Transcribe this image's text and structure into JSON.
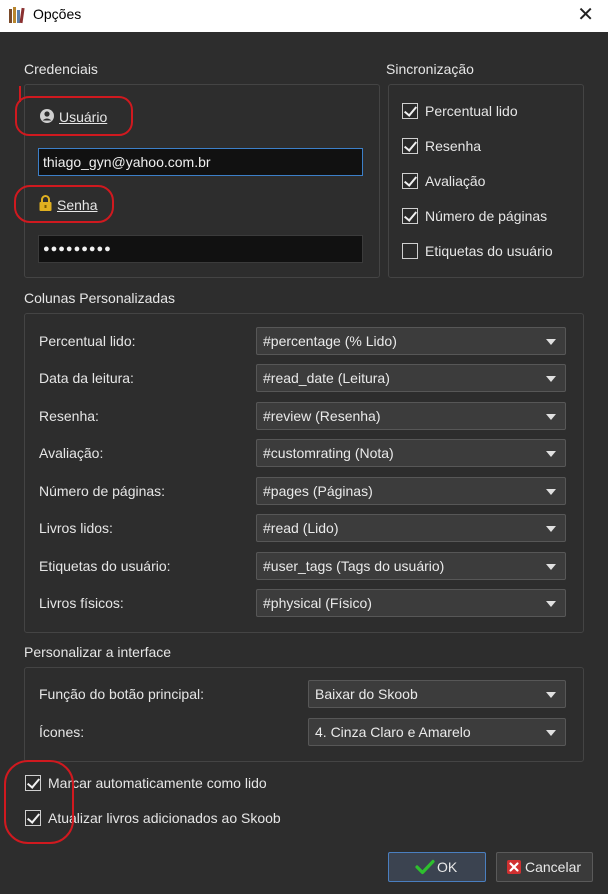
{
  "window": {
    "title": "Opções",
    "close_glyph": "✕"
  },
  "credentials": {
    "group_title": "Credenciais",
    "user_label": "Usuário",
    "user_value": "thiago_gyn@yahoo.com.br",
    "password_label": "Senha",
    "password_mask": "●●●●●●●●●"
  },
  "sync": {
    "group_title": "Sincronização",
    "items": [
      {
        "label": "Percentual lido",
        "checked": true
      },
      {
        "label": "Resenha",
        "checked": true
      },
      {
        "label": "Avaliação",
        "checked": true
      },
      {
        "label": "Número de páginas",
        "checked": true
      },
      {
        "label": "Etiquetas do usuário",
        "checked": false
      }
    ]
  },
  "columns": {
    "group_title": "Colunas Personalizadas",
    "rows": [
      {
        "label": "Percentual lido:",
        "value": "#percentage (% Lido)"
      },
      {
        "label": "Data da leitura:",
        "value": "#read_date (Leitura)"
      },
      {
        "label": "Resenha:",
        "value": "#review (Resenha)"
      },
      {
        "label": "Avaliação:",
        "value": "#customrating (Nota)"
      },
      {
        "label": "Número de páginas:",
        "value": "#pages (Páginas)"
      },
      {
        "label": "Livros lidos:",
        "value": "#read (Lido)"
      },
      {
        "label": "Etiquetas do usuário:",
        "value": "#user_tags (Tags do usuário)"
      },
      {
        "label": "Livros físicos:",
        "value": "#physical (Físico)"
      }
    ]
  },
  "interface": {
    "group_title": "Personalizar a interface",
    "main_button_label": "Função do botão principal:",
    "main_button_value": "Baixar do Skoob",
    "icons_label": "Ícones:",
    "icons_value": "4. Cinza Claro e Amarelo"
  },
  "options": {
    "auto_mark_label": "Marcar automaticamente como lido",
    "auto_mark_checked": true,
    "update_books_label": "Atualizar livros adicionados ao Skoob",
    "update_books_checked": true
  },
  "buttons": {
    "ok_label": "OK",
    "cancel_label": "Cancelar"
  },
  "colors": {
    "annotation": "#d0191f",
    "accent": "#3c7fc8",
    "background": "#2d2d2d"
  }
}
